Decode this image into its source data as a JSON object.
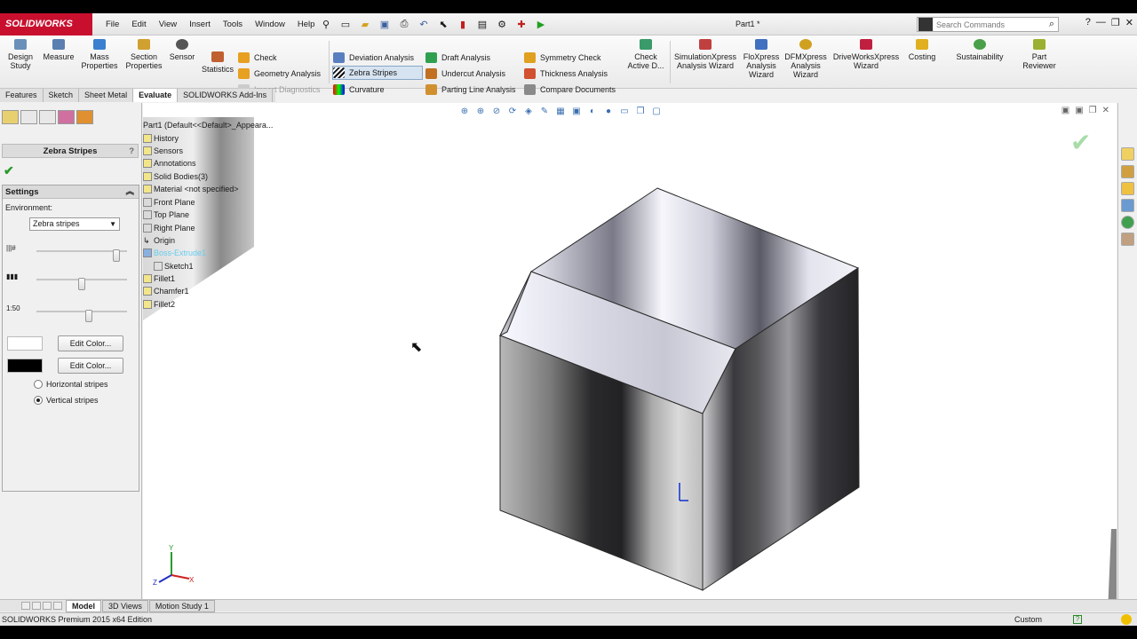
{
  "app": {
    "logo": "SOLIDWORKS",
    "doc_title": "Part1 *",
    "search_placeholder": "Search Commands"
  },
  "menu": [
    "File",
    "Edit",
    "View",
    "Insert",
    "Tools",
    "Window",
    "Help"
  ],
  "ribbon": {
    "large_buttons": [
      {
        "label": "Design\nStudy",
        "icon": "design-study-icon"
      },
      {
        "label": "Measure",
        "icon": "measure-icon"
      },
      {
        "label": "Mass\nProperties",
        "icon": "mass-properties-icon"
      },
      {
        "label": "Section\nProperties",
        "icon": "section-properties-icon"
      },
      {
        "label": "Sensor",
        "icon": "sensor-icon"
      },
      {
        "label": "Statistics",
        "icon": "statistics-icon"
      }
    ],
    "check_group": [
      "Check",
      "Geometry Analysis",
      "Import Diagnostics"
    ],
    "analysis_col1": [
      "Deviation Analysis",
      "Zebra Stripes",
      "Curvature"
    ],
    "analysis_col2": [
      "Draft Analysis",
      "Undercut Analysis",
      "Parting Line Analysis"
    ],
    "analysis_col3": [
      "Symmetry Check",
      "Thickness Analysis",
      "Compare Documents"
    ],
    "check_active": "Check\nActive D...",
    "wizards": [
      "SimulationXpress\nAnalysis Wizard",
      "FloXpress\nAnalysis\nWizard",
      "DFMXpress\nAnalysis\nWizard",
      "DriveWorksXpress\nWizard",
      "Costing",
      "Sustainability",
      "Part\nReviewer"
    ]
  },
  "command_tabs": [
    "Features",
    "Sketch",
    "Sheet Metal",
    "Evaluate",
    "SOLIDWORKS Add-Ins"
  ],
  "property_manager": {
    "title": "Zebra Stripes",
    "help": "?",
    "settings_header": "Settings",
    "environment_label": "Environment:",
    "environment_value": "Zebra stripes",
    "slider_levels": [
      0.92,
      0.5,
      0.58
    ],
    "edit_color_label": "Edit Color...",
    "swatch_colors": [
      "#ffffff",
      "#000000"
    ],
    "radio_horizontal": "Horizontal stripes",
    "radio_vertical": "Vertical stripes",
    "selected_orientation": "vertical"
  },
  "feature_tree": [
    "Part1  (Default<<Default>_Appeara...",
    "History",
    "Sensors",
    "Annotations",
    "Solid Bodies(3)",
    "Material <not specified>",
    "Front Plane",
    "Top Plane",
    "Right Plane",
    "Origin",
    "Boss-Extrude1",
    "Sketch1",
    "Fillet1",
    "Chamfer1",
    "Fillet2"
  ],
  "bottom_tabs": [
    "Model",
    "3D Views",
    "Motion Study 1"
  ],
  "status": {
    "edition": "SOLIDWORKS Premium 2015 x64 Edition",
    "units": "Custom"
  },
  "colors": {
    "brand": "#c8102e",
    "selection": "#d6e3f0",
    "ok_green": "#2a9a2a"
  }
}
